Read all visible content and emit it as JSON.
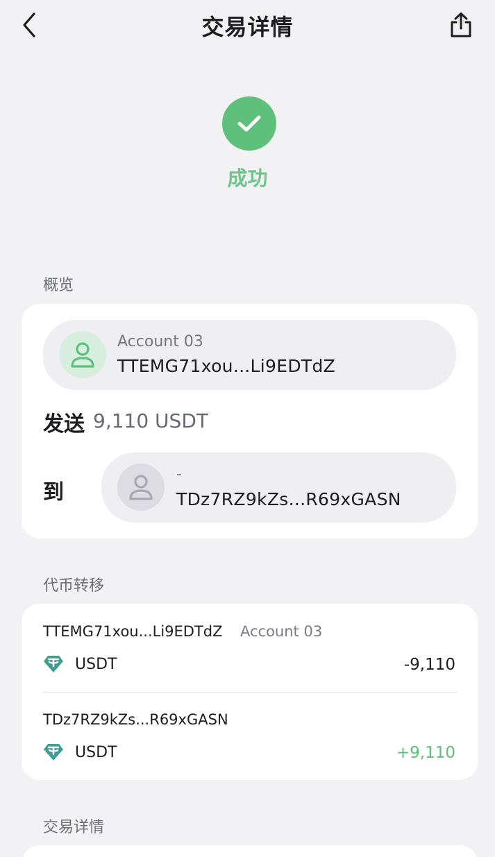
{
  "header": {
    "title": "交易详情",
    "back_icon": "chevron-left-icon",
    "share_icon": "share-icon"
  },
  "status": {
    "icon": "check-icon",
    "text": "成功",
    "color": "#5ec07a"
  },
  "overview": {
    "section_label": "概览",
    "from": {
      "name": "Account 03",
      "address": "TTEMG71xou...Li9EDTdZ",
      "avatar_icon": "user-icon"
    },
    "send_label": "发送",
    "send_amount": "9,110 USDT",
    "to_label": "到",
    "to": {
      "name": "-",
      "address": "TDz7RZ9kZs...R69xGASN",
      "avatar_icon": "user-icon"
    }
  },
  "token_transfer": {
    "section_label": "代币转移",
    "rows": [
      {
        "address": "TTEMG71xou...Li9EDTdZ",
        "account": "Account 03",
        "token": "USDT",
        "token_icon": "tether-icon",
        "amount": "-9,110",
        "amount_color": "#1c1c22"
      },
      {
        "address": "TDz7RZ9kZs...R69xGASN",
        "account": "",
        "token": "USDT",
        "token_icon": "tether-icon",
        "amount": "+9,110",
        "amount_color": "#5ec07a"
      }
    ]
  },
  "details": {
    "section_label": "交易详情"
  },
  "colors": {
    "background": "#f2f2f5",
    "card": "#ffffff",
    "success": "#5ec07a",
    "tether": "#3f9e91"
  }
}
